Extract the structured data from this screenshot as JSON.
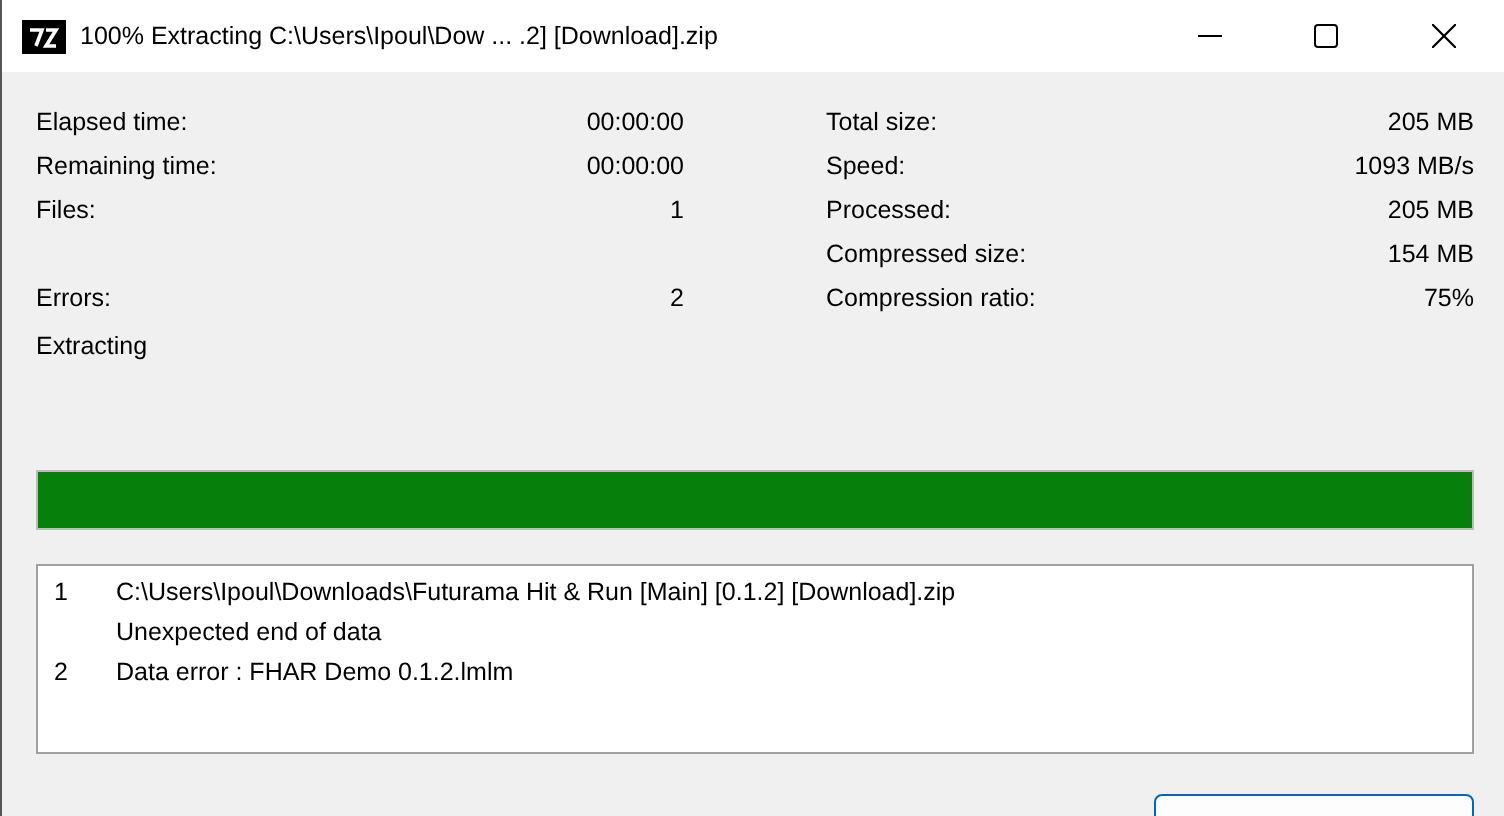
{
  "window": {
    "title": "100% Extracting C:\\Users\\Ipoul\\Dow ... .2] [Download].zip"
  },
  "left_stats": [
    {
      "kind": "stat",
      "label": "Elapsed time:",
      "value": "00:00:00"
    },
    {
      "kind": "stat",
      "label": "Remaining time:",
      "value": "00:00:00"
    },
    {
      "kind": "stat",
      "label": "Files:",
      "value": "1"
    },
    {
      "kind": "blank"
    },
    {
      "kind": "stat",
      "label": "Errors:",
      "value": "2"
    }
  ],
  "right_stats": [
    {
      "kind": "stat",
      "label": "Total size:",
      "value": "205 MB"
    },
    {
      "kind": "stat",
      "label": "Speed:",
      "value": "1093 MB/s"
    },
    {
      "kind": "stat",
      "label": "Processed:",
      "value": "205 MB"
    },
    {
      "kind": "stat",
      "label": "Compressed size:",
      "value": "154 MB"
    },
    {
      "kind": "stat",
      "label": "Compression ratio:",
      "value": "75%"
    }
  ],
  "status": "Extracting",
  "progress": {
    "level": 1
  },
  "log": [
    {
      "number": "1",
      "lines": [
        "C:\\Users\\Ipoul\\Downloads\\Futurama Hit & Run [Main] [0.1.2] [Download].zip",
        "Unexpected end of data"
      ]
    },
    {
      "number": "2",
      "lines": [
        "Data error : FHAR Demo 0.1.2.lmlm"
      ]
    }
  ]
}
